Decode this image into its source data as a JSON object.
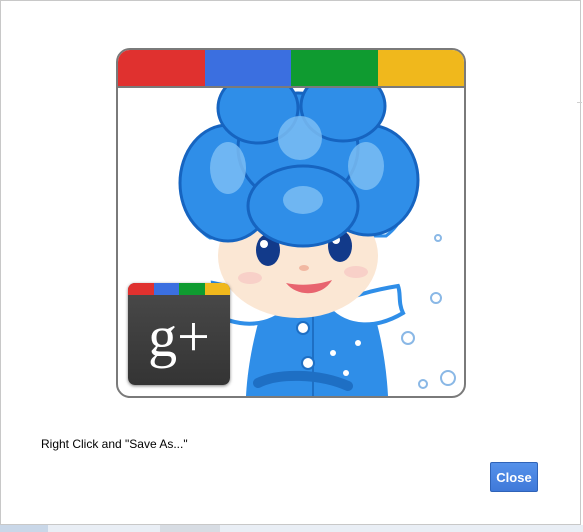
{
  "dialog": {
    "instruction_text": "Right Click and \"Save As...\"",
    "close_label": "Close"
  },
  "avatar": {
    "badge_glyph": "g+",
    "brand_colors": [
      "#e0312f",
      "#3b6fe0",
      "#0f9b30",
      "#f0b81c"
    ],
    "character_color": "#2f8ee8"
  },
  "colors": {
    "button_blue": "#4a86e4",
    "frame_gray": "#7a7a7a",
    "badge_dark": "#3d3d3d"
  }
}
